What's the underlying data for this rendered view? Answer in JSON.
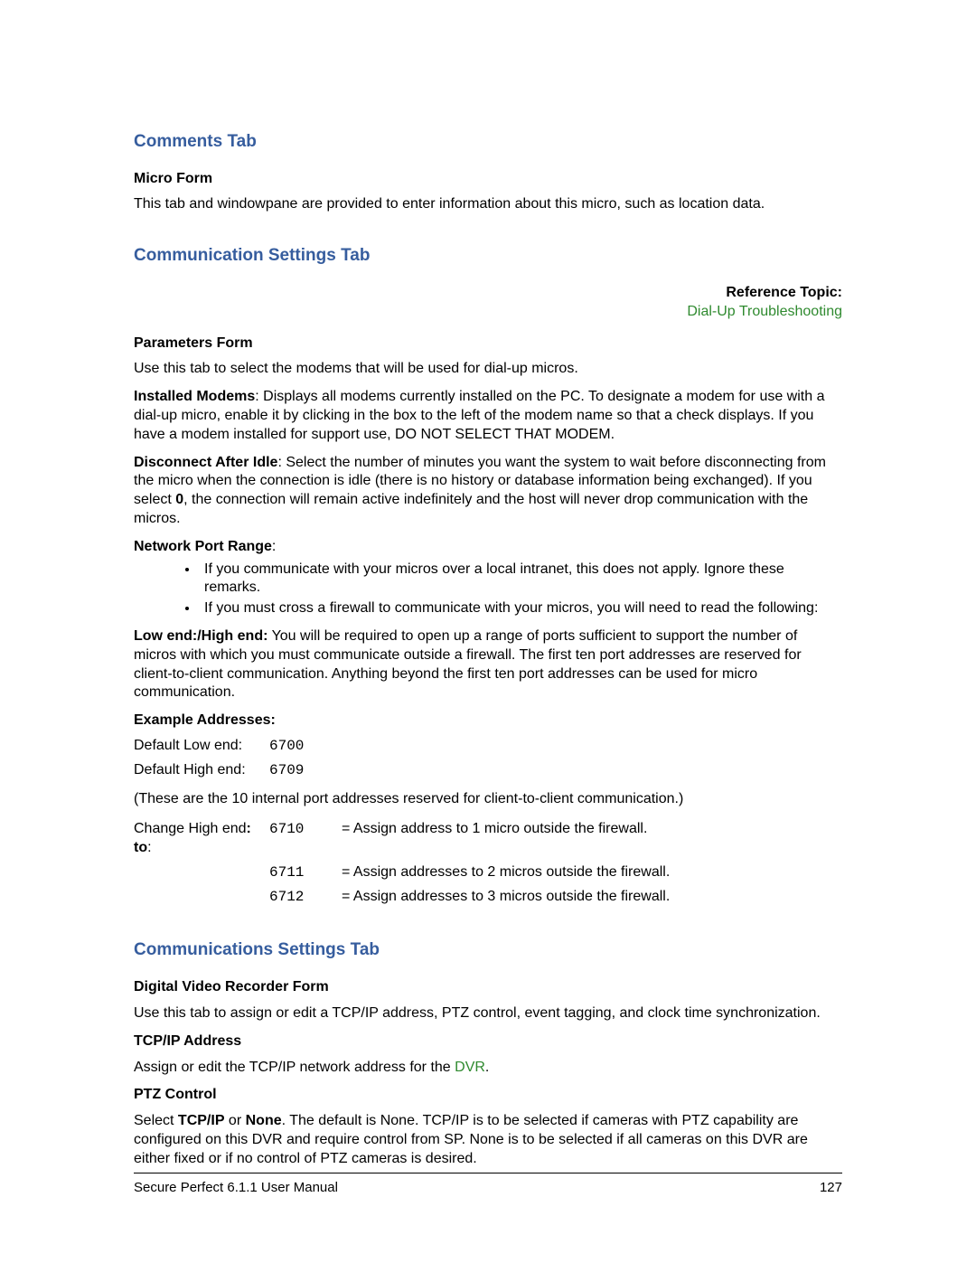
{
  "sections": {
    "comments": {
      "title": "Comments Tab",
      "sub1_head": "Micro Form",
      "sub1_body": "This tab and windowpane are provided to enter information about this micro, such as location data."
    },
    "comm1": {
      "title": "Communication Settings Tab",
      "ref_label": "Reference Topic:",
      "ref_link": "Dial-Up Troubleshooting",
      "params_head": "Parameters Form",
      "p1": "Use this tab to select the modems that will be used for dial-up micros.",
      "p2_lead": "Installed Modems",
      "p2_body": ": Displays all modems currently installed on the PC. To designate a modem for use with a dial-up micro, enable it by clicking in the box to the left of the modem name so that a check displays. If you have a modem installed for support use, DO NOT SELECT THAT MODEM.",
      "p3_lead": "Disconnect After Idle",
      "p3_body_a": ": Select the number of minutes you want the system to wait before disconnecting from the micro when the connection is idle (there is no history or database information being exchanged). If you select ",
      "p3_bold": "0",
      "p3_body_b": ", the connection will remain active indefinitely and the host will never drop communication with the micros.",
      "p4_lead": "Network Port Range",
      "p4_colon": ":",
      "bullets": {
        "a": "If you communicate with your micros over a local intranet, this does not apply. Ignore these remarks.",
        "b": "If you must cross a firewall to communicate with your micros, you will need to read the following:"
      },
      "p5_lead": "Low end:/High end:",
      "p5_body": " You will be required to open up a range of ports sufficient to support the number of micros with which you must communicate outside a firewall. The first ten port addresses are reserved for client-to-client communication. Anything beyond the first ten port addresses can be used for micro communication.",
      "ex_head": "Example Addresses:",
      "rows1": {
        "r1_label": "Default Low end:",
        "r1_port": "6700",
        "r2_label": "Default High end:",
        "r2_port": "6709"
      },
      "note": "(These are the 10 internal port addresses reserved for client-to-client communication.)",
      "rows2": {
        "r1_label_a": "Change High end",
        "r1_label_b": ": to",
        "r1_label_c": ":",
        "r1_port": "6710",
        "r1_desc": "= Assign address to 1 micro outside the firewall.",
        "r2_port": "6711",
        "r2_desc": "= Assign addresses to 2 micros outside the firewall.",
        "r3_port": "6712",
        "r3_desc": "= Assign addresses to 3 micros outside the firewall."
      }
    },
    "comm2": {
      "title": "Communications Settings Tab",
      "sub_head": "Digital Video Recorder Form",
      "p1": "Use this tab to assign or edit a TCP/IP address, PTZ control, event tagging, and clock time synchronization.",
      "h1": "TCP/IP Address",
      "p2a": "Assign or edit the TCP/IP network address for the ",
      "p2b": "DVR",
      "p2c": ".",
      "h2": "PTZ Control",
      "p3a": "Select ",
      "p3b1": "TCP/IP",
      "p3c": " or ",
      "p3b2": "None",
      "p3d": ". The default is None. TCP/IP is to be selected if cameras with PTZ capability are configured on this DVR and require control from SP. None is to be selected if all cameras on this DVR are either fixed or if no control of PTZ cameras is desired."
    }
  },
  "footer": {
    "left": "Secure Perfect 6.1.1 User Manual",
    "right": "127"
  }
}
